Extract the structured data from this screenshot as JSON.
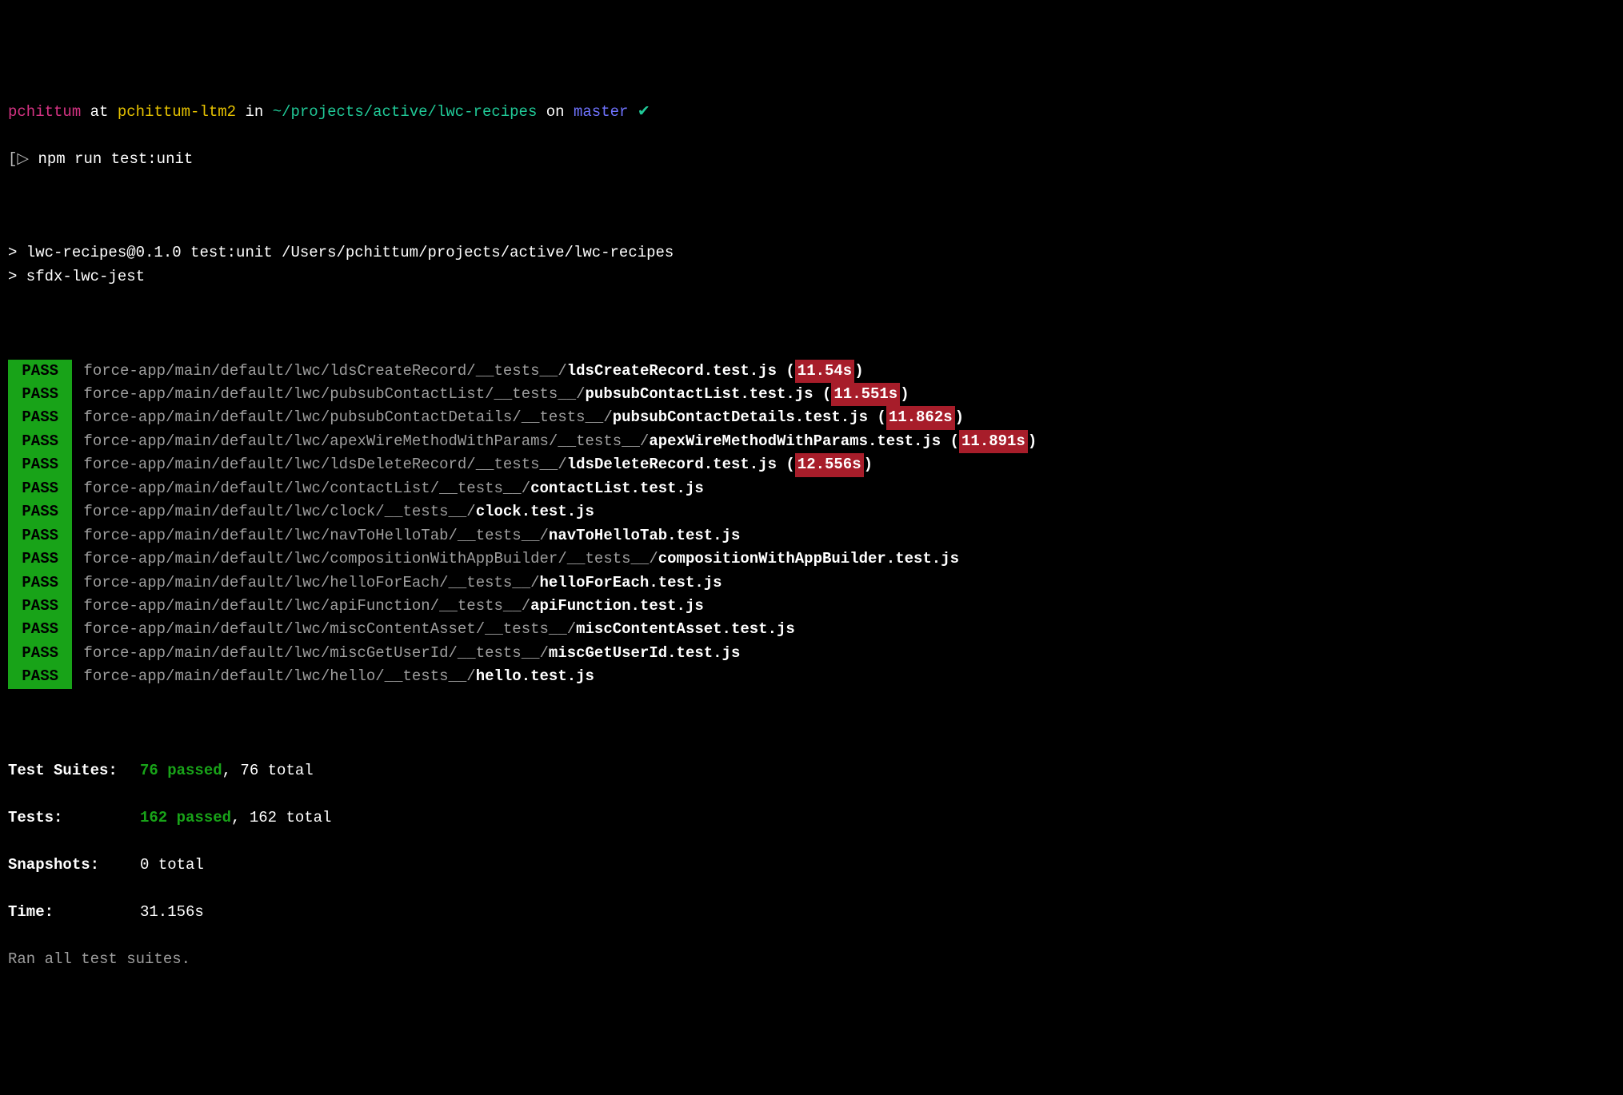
{
  "prompt": {
    "user": "pchittum",
    "at": "at",
    "host": "pchittum-ltm2",
    "in": "in",
    "path": "~/projects/active/lwc-recipes",
    "on": "on",
    "branch": "master",
    "ok": "✔"
  },
  "cmd": {
    "arrow": "▷",
    "caret": "[",
    "text": "npm run test:unit"
  },
  "script_lines": [
    "> lwc-recipes@0.1.0 test:unit /Users/pchittum/projects/active/lwc-recipes",
    "> sfdx-lwc-jest"
  ],
  "pass_label": "PASS",
  "tests": [
    {
      "path": "force-app/main/default/lwc/ldsCreateRecord/__tests__/",
      "file": "ldsCreateRecord.test.js",
      "time": "11.54s"
    },
    {
      "path": "force-app/main/default/lwc/pubsubContactList/__tests__/",
      "file": "pubsubContactList.test.js",
      "time": "11.551s"
    },
    {
      "path": "force-app/main/default/lwc/pubsubContactDetails/__tests__/",
      "file": "pubsubContactDetails.test.js",
      "time": "11.862s"
    },
    {
      "path": "force-app/main/default/lwc/apexWireMethodWithParams/__tests__/",
      "file": "apexWireMethodWithParams.test.js",
      "time": "11.891s"
    },
    {
      "path": "force-app/main/default/lwc/ldsDeleteRecord/__tests__/",
      "file": "ldsDeleteRecord.test.js",
      "time": "12.556s"
    },
    {
      "path": "force-app/main/default/lwc/contactList/__tests__/",
      "file": "contactList.test.js",
      "time": null
    },
    {
      "path": "force-app/main/default/lwc/clock/__tests__/",
      "file": "clock.test.js",
      "time": null
    },
    {
      "path": "force-app/main/default/lwc/navToHelloTab/__tests__/",
      "file": "navToHelloTab.test.js",
      "time": null
    },
    {
      "path": "force-app/main/default/lwc/compositionWithAppBuilder/__tests__/",
      "file": "compositionWithAppBuilder.test.js",
      "time": null
    },
    {
      "path": "force-app/main/default/lwc/helloForEach/__tests__/",
      "file": "helloForEach.test.js",
      "time": null
    },
    {
      "path": "force-app/main/default/lwc/apiFunction/__tests__/",
      "file": "apiFunction.test.js",
      "time": null
    },
    {
      "path": "force-app/main/default/lwc/miscContentAsset/__tests__/",
      "file": "miscContentAsset.test.js",
      "time": null
    },
    {
      "path": "force-app/main/default/lwc/miscGetUserId/__tests__/",
      "file": "miscGetUserId.test.js",
      "time": null
    },
    {
      "path": "force-app/main/default/lwc/hello/__tests__/",
      "file": "hello.test.js",
      "time": null
    }
  ],
  "summary": {
    "suites": {
      "label": "Test Suites:",
      "pass": "76 passed",
      "rest": ", 76 total"
    },
    "tests": {
      "label": "Tests:",
      "pass": "162 passed",
      "rest": ", 162 total"
    },
    "snaps": {
      "label": "Snapshots:",
      "value": "0 total"
    },
    "time": {
      "label": "Time:",
      "value": "31.156s"
    },
    "footer": "Ran all test suites."
  }
}
